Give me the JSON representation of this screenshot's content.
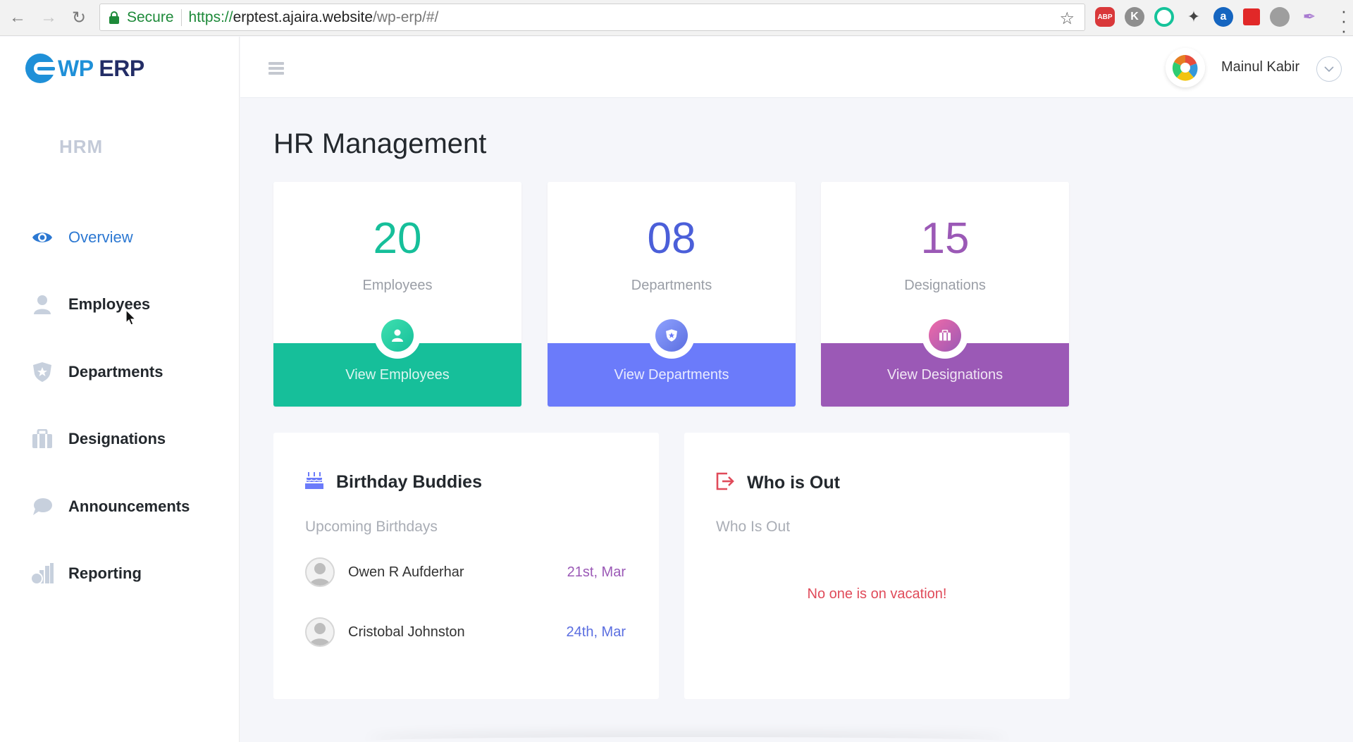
{
  "browser": {
    "secure_label": "Secure",
    "url_scheme": "https://",
    "url_host": "erptest.ajaira.website",
    "url_path": "/wp-erp/#/",
    "extensions": [
      "ABP",
      "K",
      "",
      "",
      "a",
      "",
      "",
      ""
    ]
  },
  "brand": {
    "logo_wp": "WP",
    "logo_erp": "ERP",
    "primary_color": "#1f90d8",
    "dark_color": "#232d66"
  },
  "sidebar": {
    "section_label": "HRM",
    "items": [
      {
        "label": "Overview",
        "icon": "eye-icon",
        "active": true
      },
      {
        "label": "Employees",
        "icon": "user-icon",
        "active": false
      },
      {
        "label": "Departments",
        "icon": "shield-star-icon",
        "active": false
      },
      {
        "label": "Designations",
        "icon": "briefcase-icon",
        "active": false
      },
      {
        "label": "Announcements",
        "icon": "chat-bubble-icon",
        "active": false
      },
      {
        "label": "Reporting",
        "icon": "bar-chart-icon",
        "active": false
      }
    ]
  },
  "header": {
    "user_name": "Mainul Kabir"
  },
  "main": {
    "title": "HR Management",
    "stats": [
      {
        "value": "20",
        "label": "Employees",
        "link": "View Employees",
        "color": "#16bf9a",
        "icon": "user-icon"
      },
      {
        "value": "08",
        "label": "Departments",
        "link": "View Departments",
        "color": "#6b7bfa",
        "icon": "shield-star-icon"
      },
      {
        "value": "15",
        "label": "Designations",
        "link": "View Designations",
        "color": "#9b59b6",
        "icon": "briefcase-icon"
      }
    ],
    "birthday": {
      "title": "Birthday Buddies",
      "subtitle": "Upcoming Birthdays",
      "people": [
        {
          "name": "Owen R Aufderhar",
          "date": "21st, Mar",
          "date_color": "#9b59b6"
        },
        {
          "name": "Cristobal Johnston",
          "date": "24th, Mar",
          "date_color": "#5b6ee0"
        }
      ]
    },
    "out": {
      "title": "Who is Out",
      "subtitle": "Who Is Out",
      "empty_message": "No one is on vacation!"
    }
  }
}
